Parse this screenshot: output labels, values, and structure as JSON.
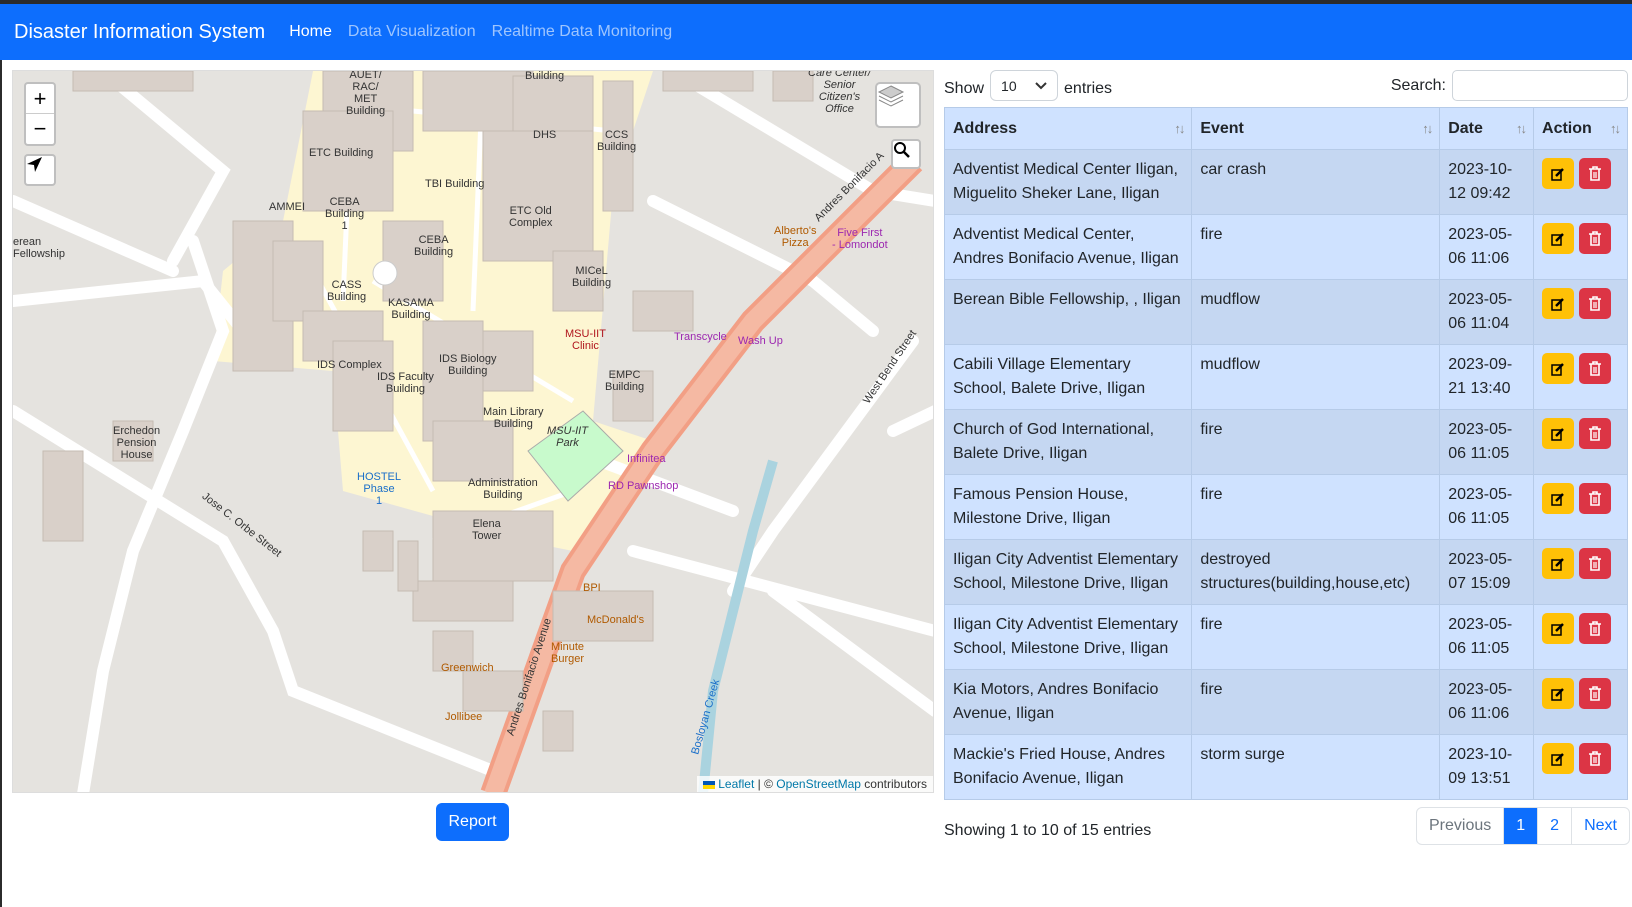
{
  "navbar": {
    "brand": "Disaster Information System",
    "links": [
      {
        "label": "Home",
        "active": true
      },
      {
        "label": "Data Visualization",
        "active": false
      },
      {
        "label": "Realtime Data Monitoring",
        "active": false
      }
    ]
  },
  "map": {
    "zoom_in": "+",
    "zoom_out": "−",
    "attribution": {
      "leaflet": "Leaflet",
      "separator": " | © ",
      "osm": "OpenStreetMap",
      "suffix": " contributors"
    },
    "labels": {
      "auet": "AUET/\nRAC/\nMET\nBuilding",
      "building_top": "Building",
      "care_center": "Care Center/\nSenior\nCitizen's\nOffice",
      "dhs": "DHS",
      "ccs": "CCS\nBuilding",
      "etc": "ETC Building",
      "tbi": "TBI Building",
      "ammei": "AMMEI",
      "ceba1": "CEBA\nBuilding\n1",
      "ceba": "CEBA\nBuilding",
      "etc_old": "ETC Old\nComplex",
      "alberto": "Alberto's\nPizza",
      "five_first": "Five First\n- Lomondot",
      "berean": "erean\nFellowship",
      "micel": "MICeL\nBuilding",
      "cass": "CASS\nBuilding",
      "kasama": "KASAMA\nBuilding",
      "clinic": "MSU-IIT\nClinic",
      "transcycle": "Transcycle",
      "wash_up": "Wash Up",
      "ids_complex": "IDS Complex",
      "ids_biology": "IDS Biology\nBuilding",
      "ids_faculty": "IDS Faculty\nBuilding",
      "empc": "EMPC\nBuilding",
      "west_bend": "West Bend Street",
      "main_library": "Main Library\nBuilding",
      "park": "MSU-IIT\nPark",
      "erchedon": "Erchedon\nPension\nHouse",
      "hostel": "HOSTEL\nPhase\n1",
      "infinitea": "Infinitea",
      "rd_pawnshop": "RD Pawnshop",
      "admin": "Administration\nBuilding",
      "jose": "Jose C. Orbe Street",
      "elena": "Elena\nTower",
      "bpi": "BPI",
      "mcdonalds": "McDonald's",
      "minute_burger": "Minute\nBurger",
      "greenwich": "Greenwich",
      "andres_bottom": "Andres Bonifacio Avenue",
      "andres_top": "Andres Bonifacio A",
      "jollibee": "Jollibee",
      "bosloyan": "Bosloyan Creek"
    }
  },
  "report_button": "Report",
  "table_controls": {
    "show_label": "Show",
    "entries_value": "10",
    "entries_label": "entries",
    "search_label": "Search:",
    "search_value": ""
  },
  "table": {
    "columns": [
      "Address",
      "Event",
      "Date",
      "Action"
    ],
    "rows": [
      {
        "address": "Adventist Medical Center Iligan, Miguelito Sheker Lane, Iligan",
        "event": "car crash",
        "date": "2023-10-12 09:42"
      },
      {
        "address": "Adventist Medical Center, Andres Bonifacio Avenue, Iligan",
        "event": "fire",
        "date": "2023-05-06 11:06"
      },
      {
        "address": "Berean Bible Fellowship, , Iligan",
        "event": "mudflow",
        "date": "2023-05-06 11:04"
      },
      {
        "address": "Cabili Village Elementary School, Balete Drive, Iligan",
        "event": "mudflow",
        "date": "2023-09-21 13:40"
      },
      {
        "address": "Church of God International, Balete Drive, Iligan",
        "event": "fire",
        "date": "2023-05-06 11:05"
      },
      {
        "address": "Famous Pension House, Milestone Drive, Iligan",
        "event": "fire",
        "date": "2023-05-06 11:05"
      },
      {
        "address": "Iligan City Adventist Elementary School, Milestone Drive, Iligan",
        "event": "destroyed structures(building,house,etc)",
        "date": "2023-05-07 15:09"
      },
      {
        "address": "Iligan City Adventist Elementary School, Milestone Drive, Iligan",
        "event": "fire",
        "date": "2023-05-06 11:05"
      },
      {
        "address": "Kia Motors, Andres Bonifacio Avenue, Iligan",
        "event": "fire",
        "date": "2023-05-06 11:06"
      },
      {
        "address": "Mackie's Fried House, Andres Bonifacio Avenue, Iligan",
        "event": "storm surge",
        "date": "2023-10-09 13:51"
      }
    ]
  },
  "footer": {
    "info": "Showing 1 to 10 of 15 entries",
    "pagination": [
      "Previous",
      "1",
      "2",
      "Next"
    ]
  }
}
